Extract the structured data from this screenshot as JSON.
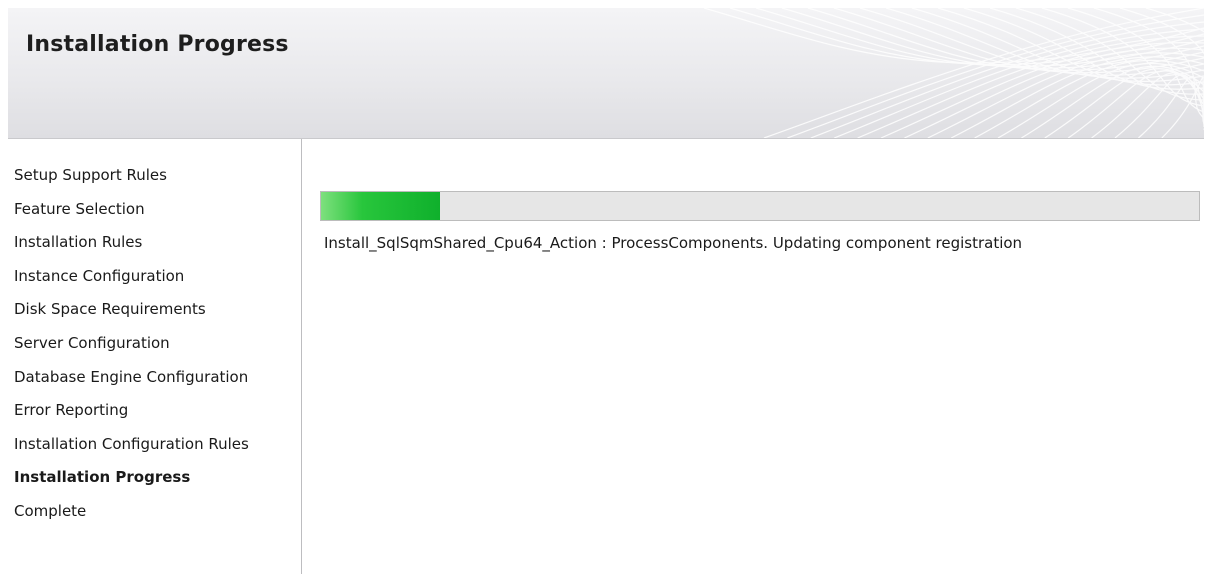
{
  "window": {
    "header_title": "Installation Progress"
  },
  "nav": {
    "items": [
      {
        "label": "Setup Support Rules",
        "active": false
      },
      {
        "label": "Feature Selection",
        "active": false
      },
      {
        "label": "Installation Rules",
        "active": false
      },
      {
        "label": "Instance Configuration",
        "active": false
      },
      {
        "label": "Disk Space Requirements",
        "active": false
      },
      {
        "label": "Server Configuration",
        "active": false
      },
      {
        "label": "Database Engine Configuration",
        "active": false
      },
      {
        "label": "Error Reporting",
        "active": false
      },
      {
        "label": "Installation Configuration Rules",
        "active": false
      },
      {
        "label": "Installation Progress",
        "active": true
      },
      {
        "label": "Complete",
        "active": false
      }
    ]
  },
  "main": {
    "progress_percent": 13.5,
    "status_text": "Install_SqlSqmShared_Cpu64_Action : ProcessComponents. Updating component registration"
  },
  "colors": {
    "progress_fill": "#0fb02c",
    "progress_track": "#e6e6e6",
    "header_bg": "#e9e9ec"
  }
}
